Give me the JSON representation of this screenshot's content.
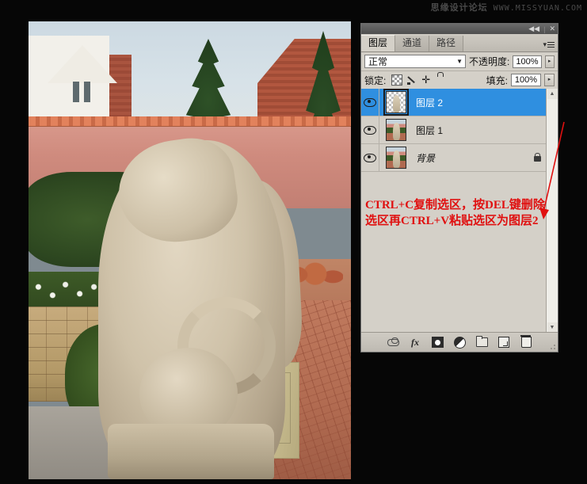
{
  "watermark": {
    "site_name": "思缘设计论坛",
    "url": "WWW.MISSYUAN.COM"
  },
  "document": {
    "title": "lion-statue-garden-photo",
    "description": "Garden photograph with two stone lion statues, houses, conifer trees, flowering bed, hedge, stone wall and brick patio with orange chairs"
  },
  "layers_panel": {
    "titlebar": {
      "collapse_label": "◀◀",
      "separator": "|",
      "close_label": "✕"
    },
    "tabs": [
      {
        "label": "图层",
        "active": true
      },
      {
        "label": "通道",
        "active": false
      },
      {
        "label": "路径",
        "active": false
      }
    ],
    "panel_menu_label": "▾",
    "blend_mode": {
      "value": "正常",
      "caret": "▼"
    },
    "opacity": {
      "label": "不透明度:",
      "value": "100%",
      "spinner": "▸"
    },
    "lock": {
      "label": "锁定:",
      "icons": [
        "lock-transparency-icon",
        "lock-image-icon",
        "lock-position-icon",
        "lock-all-icon"
      ]
    },
    "fill": {
      "label": "填充:",
      "value": "100%",
      "spinner": "▸"
    },
    "layers": [
      {
        "name": "图层 2",
        "selected": true,
        "visible": true,
        "transparent_thumb": true,
        "locked": false,
        "italic": false
      },
      {
        "name": "图层 1",
        "selected": false,
        "visible": true,
        "transparent_thumb": false,
        "locked": false,
        "italic": false
      },
      {
        "name": "背景",
        "selected": false,
        "visible": true,
        "transparent_thumb": false,
        "locked": true,
        "italic": true
      }
    ],
    "scrollbar": {
      "up_arrow": "▲",
      "down_arrow": "▼"
    },
    "footer_buttons": [
      {
        "name": "link-layers-button",
        "icon": "link-icon"
      },
      {
        "name": "layer-style-button",
        "icon": "fx-icon",
        "label": "fx"
      },
      {
        "name": "add-mask-button",
        "icon": "mask-icon"
      },
      {
        "name": "adjustment-layer-button",
        "icon": "adjustment-icon"
      },
      {
        "name": "new-group-button",
        "icon": "folder-icon"
      },
      {
        "name": "new-layer-button",
        "icon": "new-layer-icon"
      },
      {
        "name": "delete-layer-button",
        "icon": "trash-icon"
      }
    ]
  },
  "annotation": {
    "text": "CTRL+C复制选区，按DEL键删除\n选区再CTRL+V粘贴选区为图层2",
    "color": "#e01010",
    "arrow": {
      "from": "upper-right",
      "to": "lower-left",
      "points_at": "图层 2 annotation target"
    }
  },
  "colors": {
    "panel_bg": "#d4d0c8",
    "selection_blue": "#2f8fe0",
    "annotation_red": "#e01010",
    "canvas_black": "#060606",
    "titlebar_gray": "#5a5a5a"
  }
}
